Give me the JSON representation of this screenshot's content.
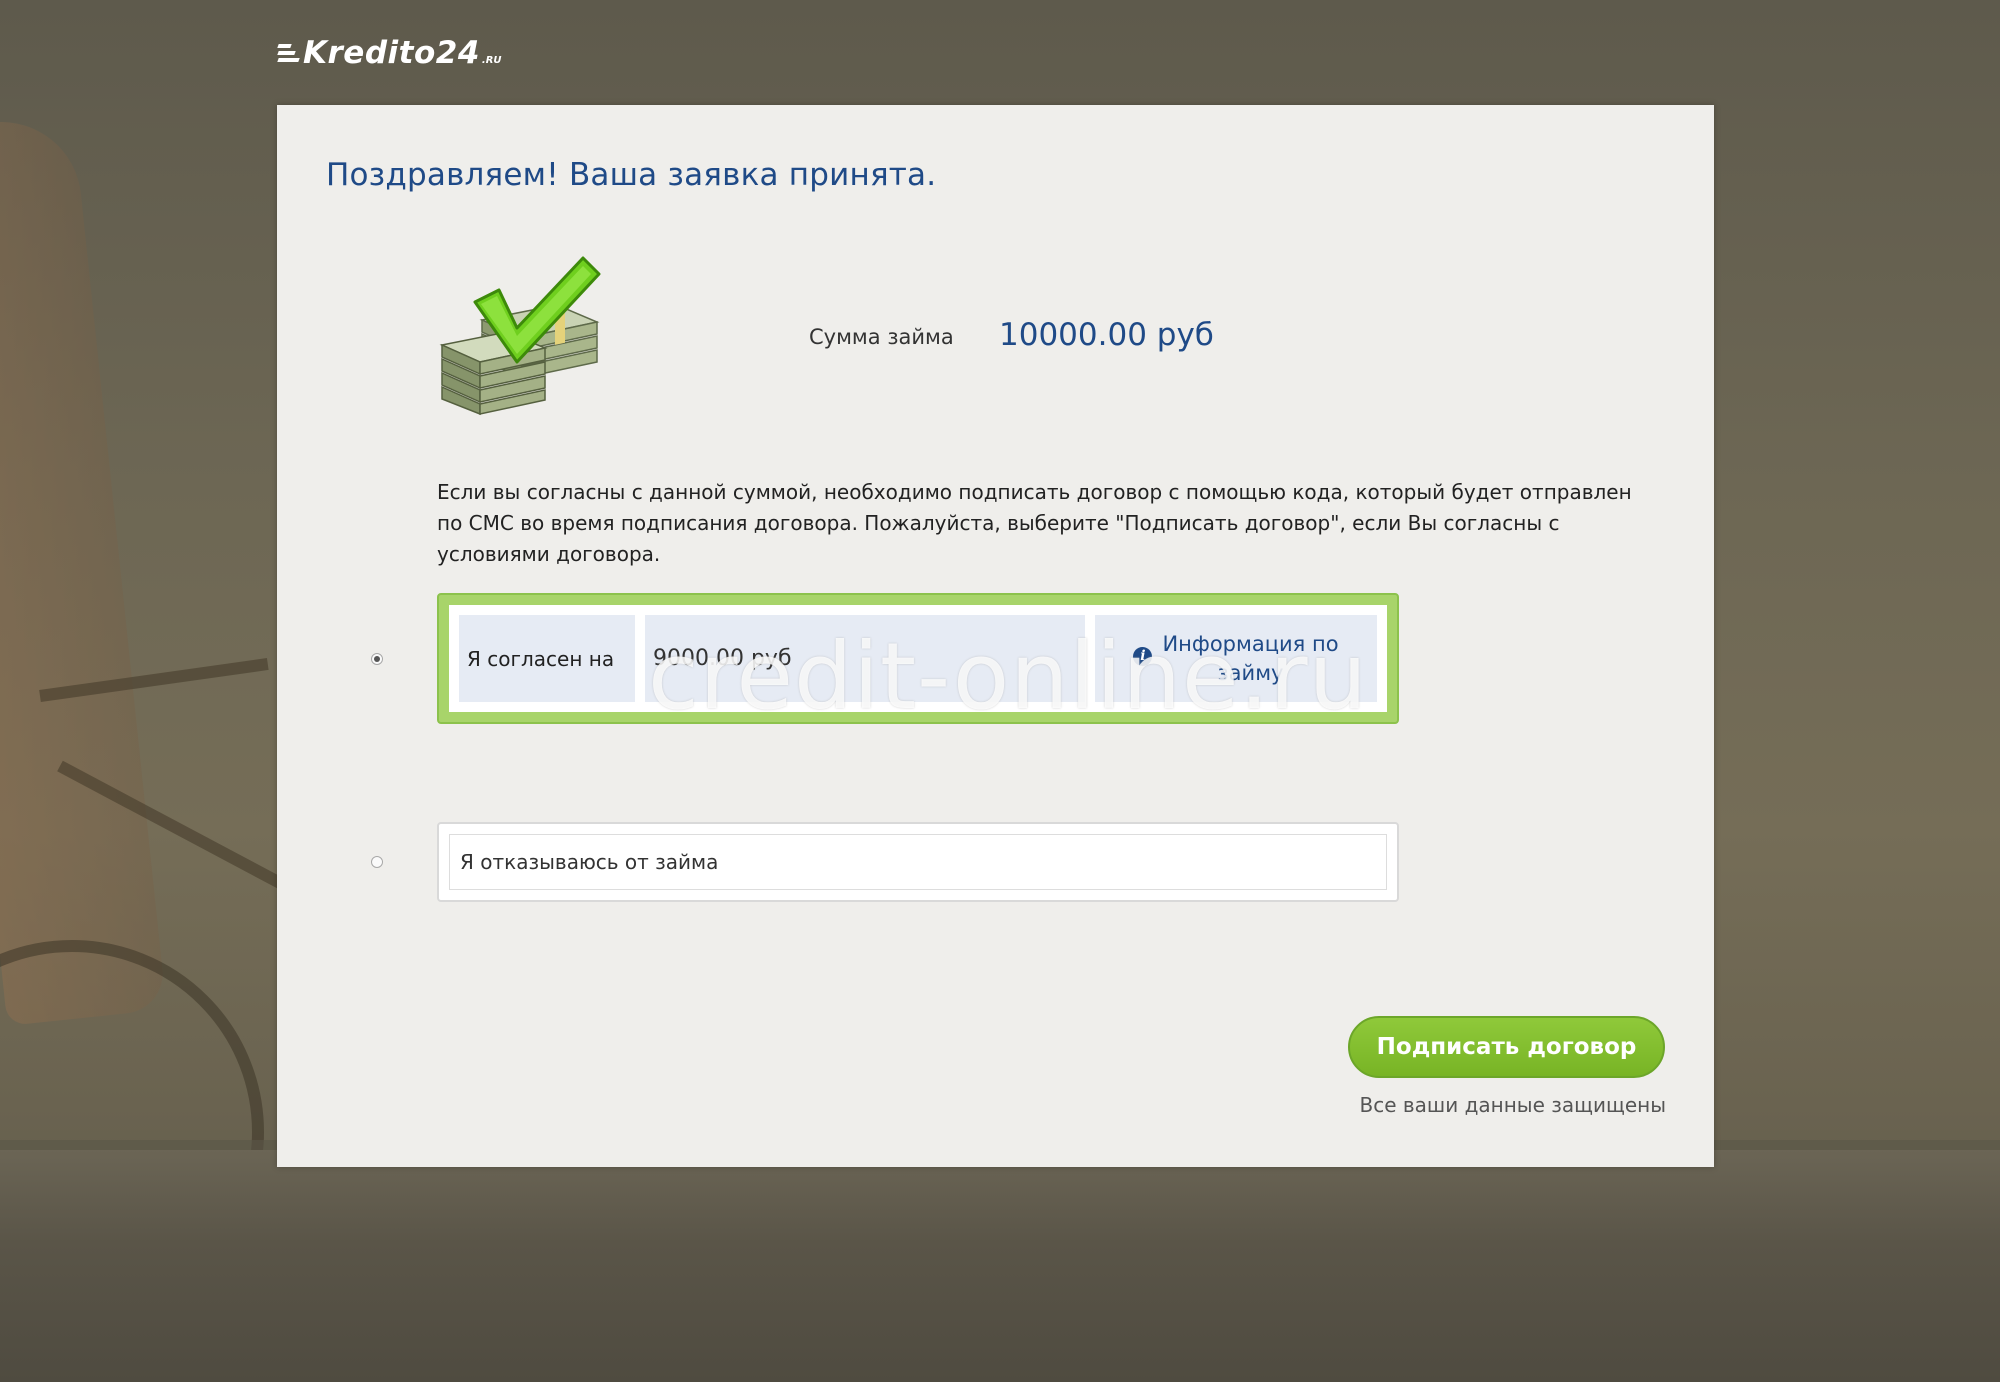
{
  "brand": {
    "logo_text": "Kredito24",
    "logo_suffix": ".RU"
  },
  "page": {
    "title": "Поздравляем! Ваша заявка принята."
  },
  "loan": {
    "label": "Сумма займа",
    "value": "10000.00 руб"
  },
  "description": "Если вы согласны с данной суммой, необходимо подписать договор с помощью кода, который будет отправлен по СМС во время подписания договора. Пожалуйста, выберите \"Подписать договор\", если Вы согласны с условиями договора.",
  "options": {
    "accept": {
      "selected": true,
      "label": "Я согласен на",
      "amount": "9000.00 руб",
      "info_line1": "Информация по",
      "info_line2": "займу"
    },
    "decline": {
      "selected": false,
      "label": "Я отказываюсь от займа"
    }
  },
  "actions": {
    "sign_label": "Подписать договор",
    "secure_note": "Все ваши данные защищены"
  },
  "watermark": "credit-online.ru",
  "colors": {
    "accent_green": "#8cc24c",
    "title_blue": "#1f4a87",
    "card_bg": "#efeeeb"
  },
  "icons": {
    "money": "money-check-icon",
    "info": "info-icon"
  }
}
